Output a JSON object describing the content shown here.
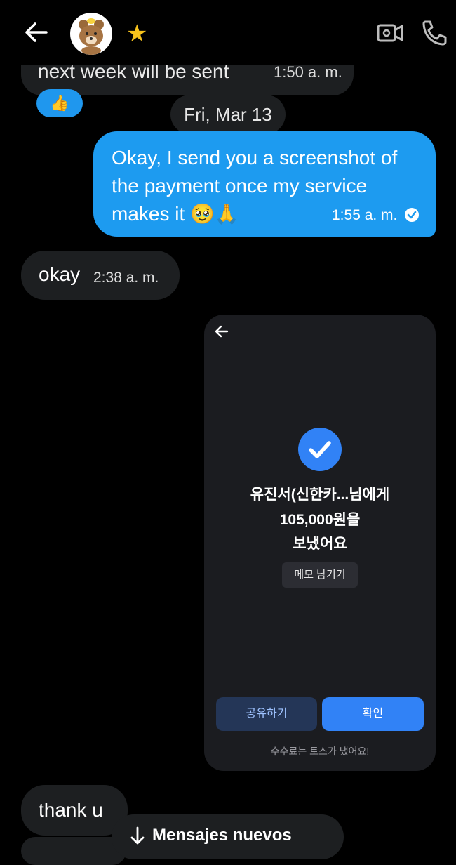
{
  "header": {
    "back_icon": "arrow-left-icon",
    "avatar_icon": "bear-avatar",
    "star": "★",
    "video_icon": "video-camera-icon",
    "call_icon": "phone-icon"
  },
  "messages": {
    "old": {
      "text": "next week will be sent",
      "time": "1:50 a. m."
    },
    "reaction": "👍",
    "date_divider": "Fri, Mar 13",
    "outgoing": {
      "text": "Okay, I send you a screenshot of the payment once my service makes it 🥹🙏",
      "time": "1:55 a. m."
    },
    "incoming1": {
      "text": "okay",
      "time": "2:38 a. m."
    },
    "incoming2": {
      "text": "thank u"
    }
  },
  "payment_screenshot": {
    "line1": "유진서(신한카...님에게",
    "line2": "105,000원을",
    "line3": "보냈어요",
    "memo_button": "메모 남기기",
    "share_button": "공유하기",
    "confirm_button": "확인",
    "fee_note": "수수료는 토스가 냈어요!",
    "accent_color": "#3182f6"
  },
  "new_messages_pill": {
    "label": "Mensajes nuevos"
  }
}
